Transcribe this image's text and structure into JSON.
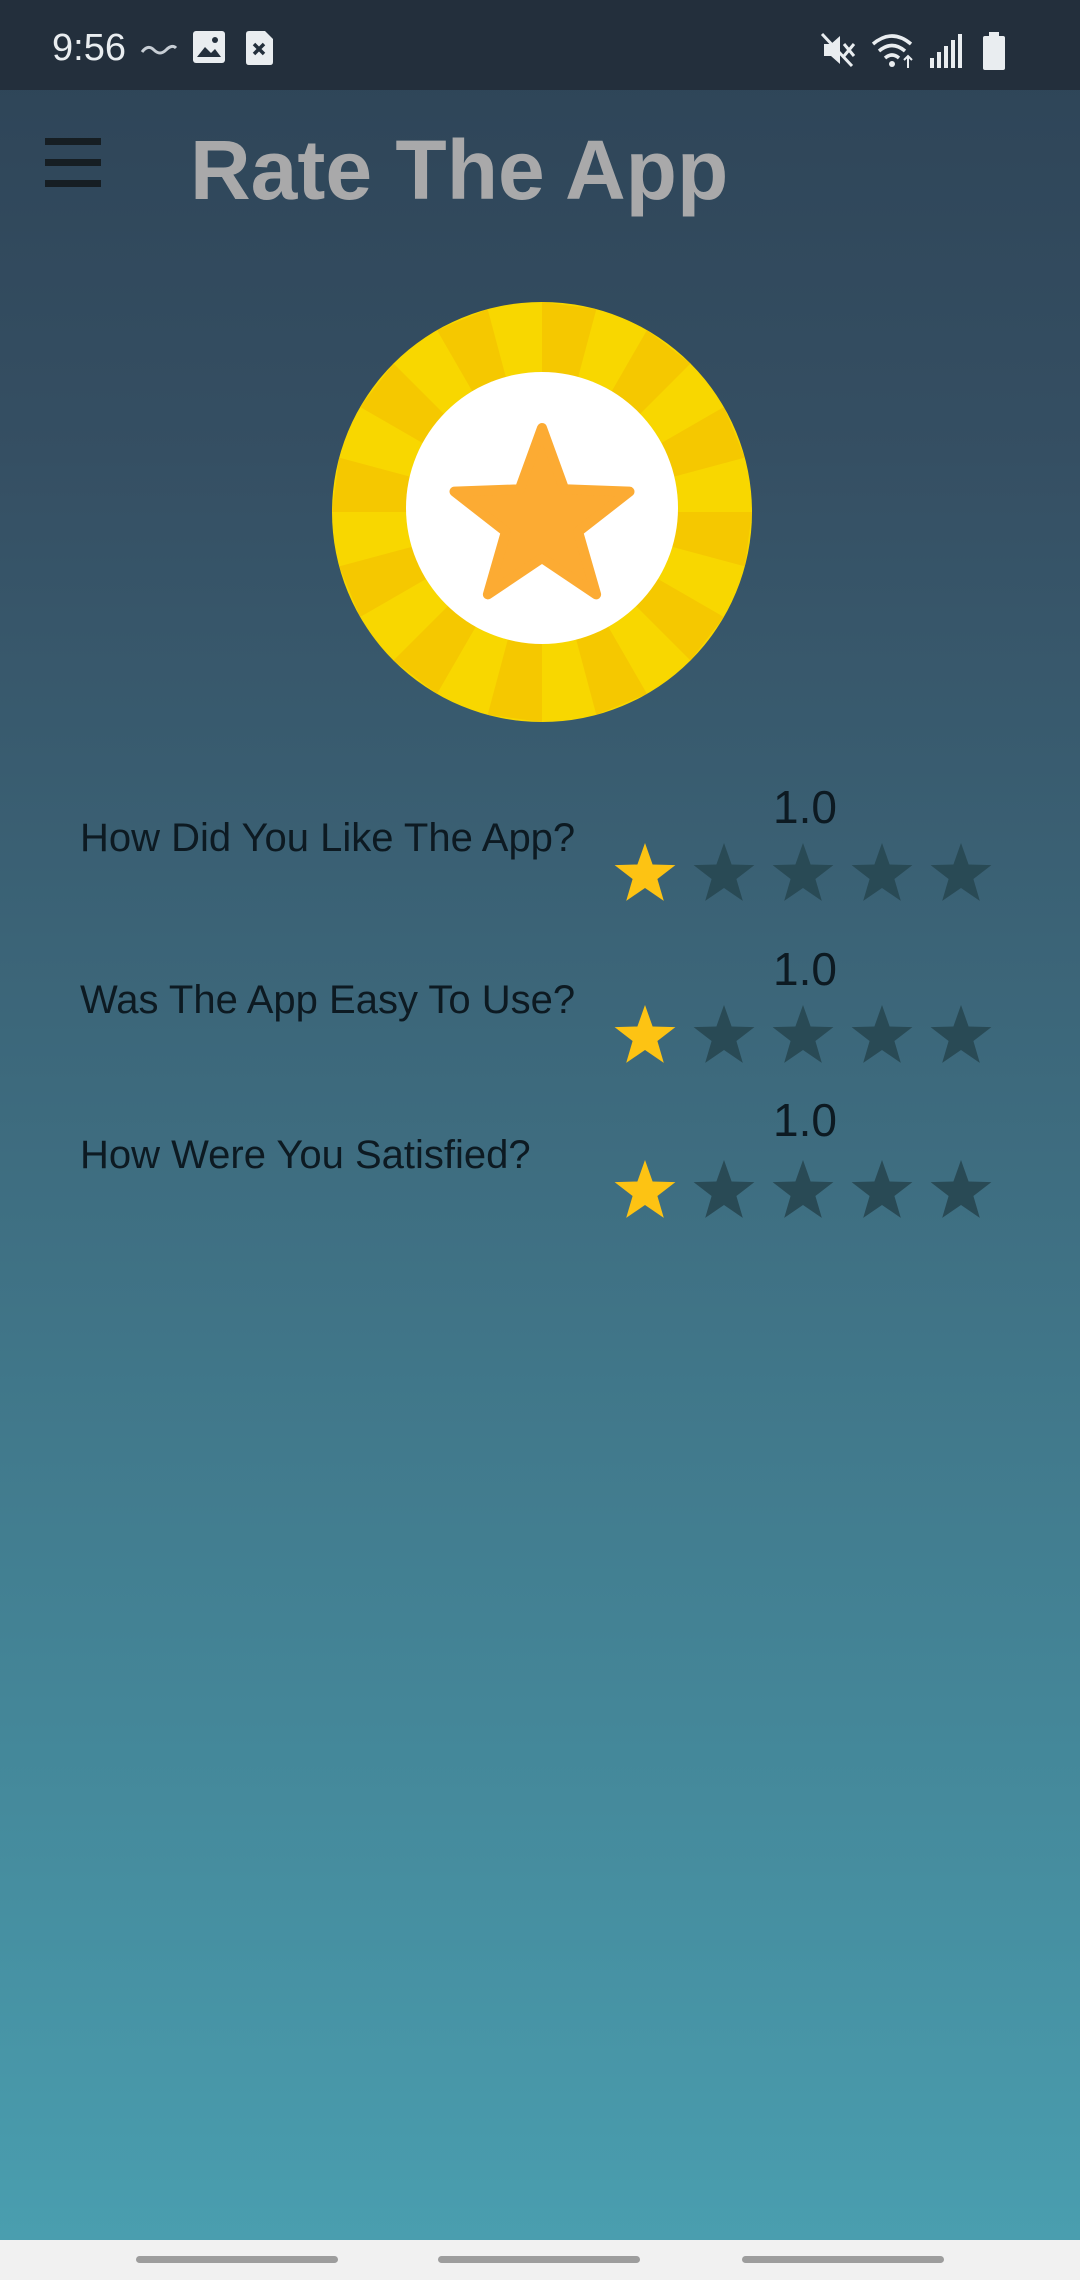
{
  "status_bar": {
    "time": "9:56",
    "left_icons": [
      "wave-icon",
      "image-icon",
      "close-box-icon"
    ],
    "right_icons": [
      "mute-icon",
      "wifi-icon",
      "signal-icon",
      "battery-icon"
    ]
  },
  "app_bar": {
    "title": "Rate The App",
    "menu_icon": "menu-icon"
  },
  "hero": {
    "icon": "star-badge-icon"
  },
  "questions": [
    {
      "label": "How Did You Like The App?",
      "score": "1.0",
      "rating": 1,
      "max": 5
    },
    {
      "label": "Was The App Easy To Use?",
      "score": "1.0",
      "rating": 1,
      "max": 5
    },
    {
      "label": "How Were You Satisfied?",
      "score": "1.0",
      "rating": 1,
      "max": 5
    }
  ],
  "colors": {
    "star_filled": "#fdc313",
    "star_empty": "#294a55",
    "title": "#a9a9aa",
    "status_bar_bg": "#232f3c",
    "badge_outer": "#f8d700",
    "badge_star": "#fcab33"
  }
}
